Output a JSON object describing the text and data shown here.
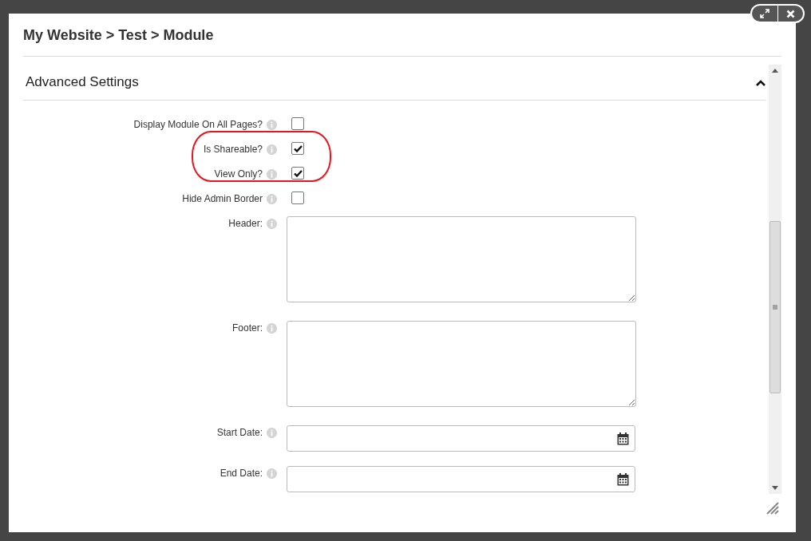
{
  "breadcrumb": "My Website > Test > Module",
  "section": {
    "title": "Advanced Settings",
    "expanded": true
  },
  "fields": [
    {
      "kind": "checkbox",
      "label": "Display Module On All Pages?",
      "checked": false,
      "highlighted": false
    },
    {
      "kind": "checkbox",
      "label": "Is Shareable?",
      "checked": true,
      "highlighted": true
    },
    {
      "kind": "checkbox",
      "label": "View Only?",
      "checked": true,
      "highlighted": true
    },
    {
      "kind": "checkbox",
      "label": "Hide Admin Border",
      "checked": false,
      "highlighted": false
    },
    {
      "kind": "textarea",
      "label": "Header:",
      "highlighted": false
    },
    {
      "kind": "textarea",
      "label": "Footer:",
      "highlighted": false
    },
    {
      "kind": "date",
      "label": "Start Date:",
      "highlighted": false
    },
    {
      "kind": "date",
      "label": "End Date:",
      "highlighted": false
    }
  ]
}
